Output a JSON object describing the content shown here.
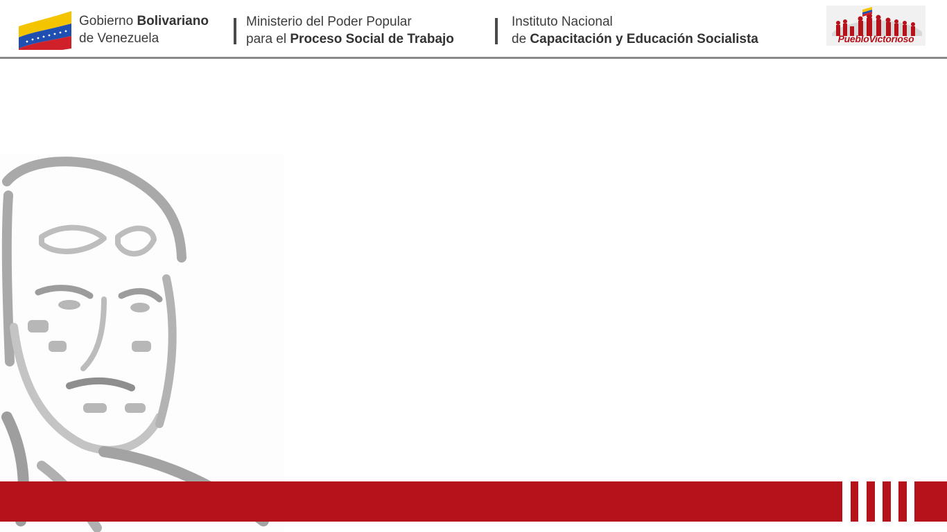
{
  "header": {
    "gobierno": {
      "line1_regular": "Gobierno ",
      "line1_bold": "Bolivariano",
      "line2": "de Venezuela"
    },
    "ministerio": {
      "line1": "Ministerio del Poder Popular",
      "line2_regular": "para el ",
      "line2_bold": "Proceso Social de Trabajo"
    },
    "instituto": {
      "line1": "Instituto Nacional",
      "line2_regular": "de ",
      "line2_bold": "Capacitación y Educación Socialista"
    },
    "logo_text": "PuebloVictorioso"
  },
  "colors": {
    "brand_red": "#b5121b",
    "rule_gray": "#8a8a8a"
  }
}
